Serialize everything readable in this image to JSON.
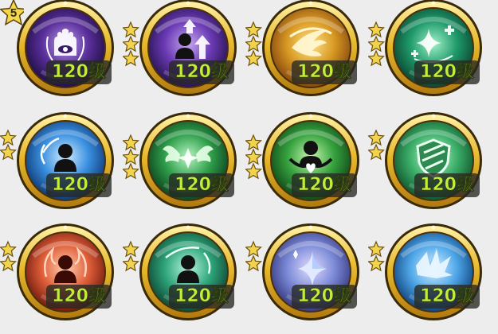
{
  "first_badge_count": "5",
  "skills": [
    {
      "level": "120级",
      "icon": "hand-eye-icon",
      "stars": 0,
      "badge": true,
      "colors": [
        "#b79ae8",
        "#5a2f9a",
        "#22104a"
      ]
    },
    {
      "level": "120级",
      "icon": "power-up-arrows-icon",
      "stars": 3,
      "badge": false,
      "colors": [
        "#c6a8f0",
        "#6a3ab4",
        "#2b1656"
      ]
    },
    {
      "level": "120级",
      "icon": "wing-strike-icon",
      "stars": 3,
      "badge": false,
      "colors": [
        "#ffe58a",
        "#d99a24",
        "#8a4c10"
      ]
    },
    {
      "level": "120级",
      "icon": "sparkle-heal-icon",
      "stars": 3,
      "badge": false,
      "colors": [
        "#9ff0c8",
        "#1f9a6a",
        "#0c4a34"
      ]
    },
    {
      "level": "120级",
      "icon": "ice-person-icon",
      "stars": 2,
      "badge": false,
      "colors": [
        "#d0ecff",
        "#3a8fe0",
        "#103e7a"
      ]
    },
    {
      "level": "120级",
      "icon": "winged-star-icon",
      "stars": 3,
      "badge": false,
      "colors": [
        "#b6f5c2",
        "#2f9e4a",
        "#0f4a22"
      ]
    },
    {
      "level": "120级",
      "icon": "heart-person-icon",
      "stars": 3,
      "badge": false,
      "colors": [
        "#c8f7b0",
        "#36a23e",
        "#11501a"
      ]
    },
    {
      "level": "120级",
      "icon": "shield-icon",
      "stars": 2,
      "badge": false,
      "colors": [
        "#c4f7d4",
        "#3db06a",
        "#125a30"
      ]
    },
    {
      "level": "120级",
      "icon": "fire-person-icon",
      "stars": 2,
      "badge": false,
      "colors": [
        "#ffcfb0",
        "#e0603a",
        "#7a1e10"
      ]
    },
    {
      "level": "120级",
      "icon": "wind-person-icon",
      "stars": 2,
      "badge": false,
      "colors": [
        "#b6f5de",
        "#2fa57a",
        "#0f4e38"
      ]
    },
    {
      "level": "120级",
      "icon": "crystal-star-icon",
      "stars": 2,
      "badge": false,
      "colors": [
        "#e2dcff",
        "#7d8cd8",
        "#3a3e86"
      ]
    },
    {
      "level": "120级",
      "icon": "ice-shard-icon",
      "stars": 2,
      "badge": false,
      "colors": [
        "#d8f2ff",
        "#4fa7e8",
        "#134a86"
      ]
    }
  ]
}
